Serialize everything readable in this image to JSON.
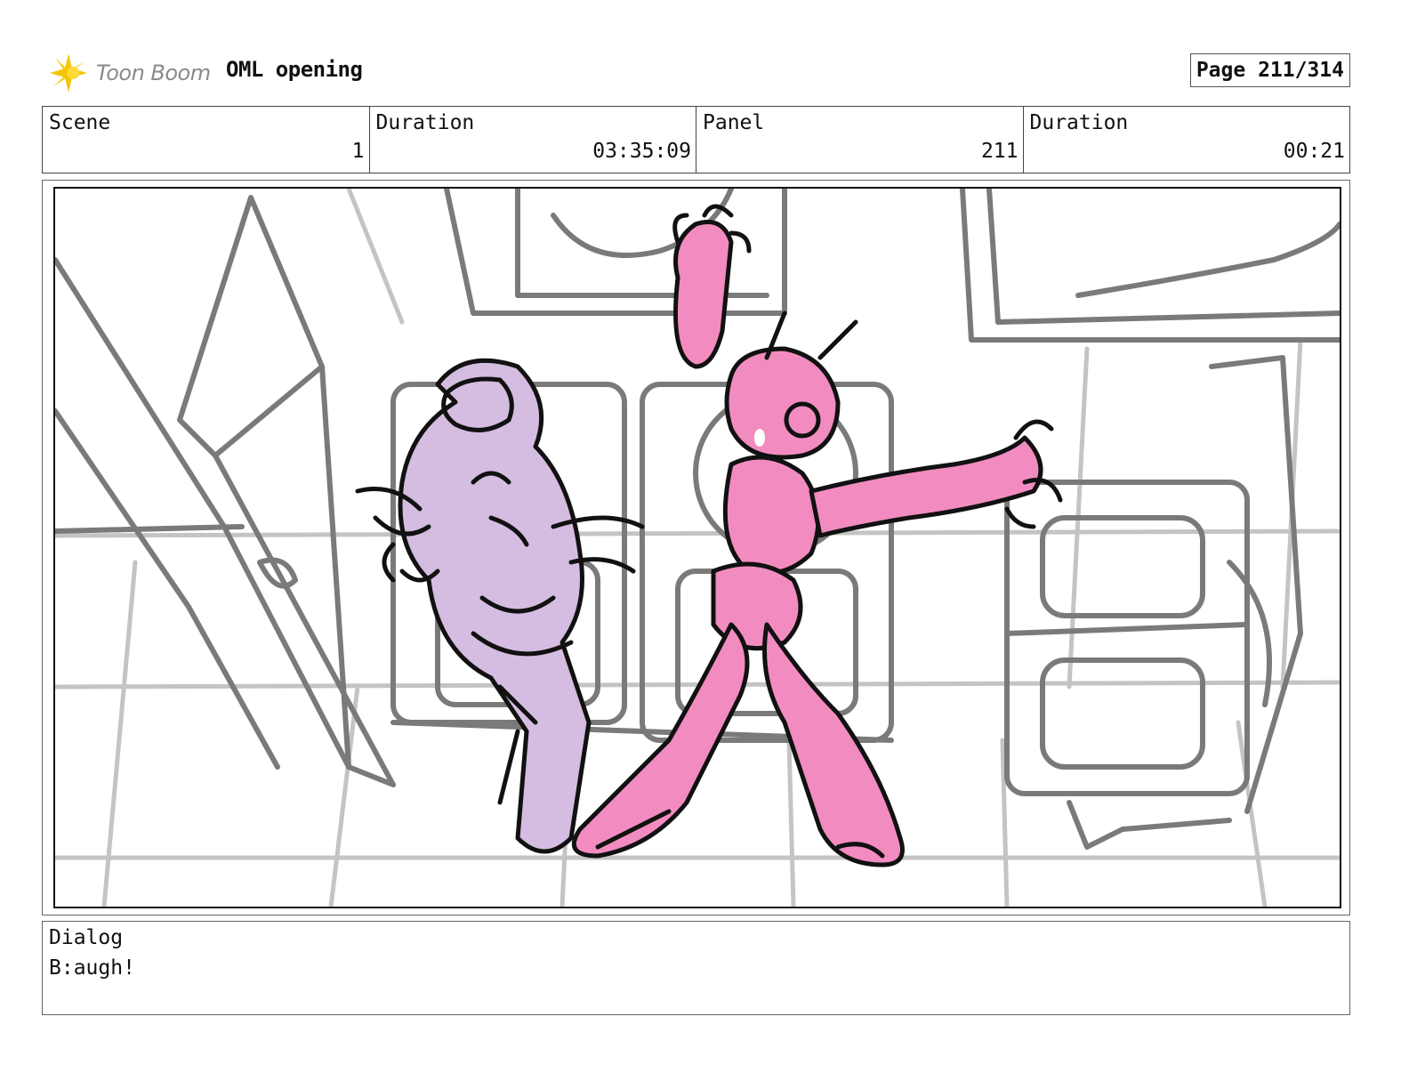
{
  "header": {
    "brand": "Toon Boom",
    "project_title": "OML opening",
    "page_label": "Page 211/314"
  },
  "info": {
    "scene_label": "Scene",
    "scene_value": "1",
    "scene_duration_label": "Duration",
    "scene_duration_value": "03:35:09",
    "panel_label": "Panel",
    "panel_value": "211",
    "panel_duration_label": "Duration",
    "panel_duration_value": "00:21"
  },
  "dialog": {
    "label": "Dialog",
    "text": "B:augh!"
  },
  "colors": {
    "logo_yellow": "#f5c400",
    "pink_character": "#f28cc0",
    "lavender_character": "#d4bde0",
    "sketch_gray": "#7a7a7a",
    "floor_gray": "#c4c4c4"
  },
  "icons": {
    "logo": "toon-boom-starburst-icon"
  }
}
